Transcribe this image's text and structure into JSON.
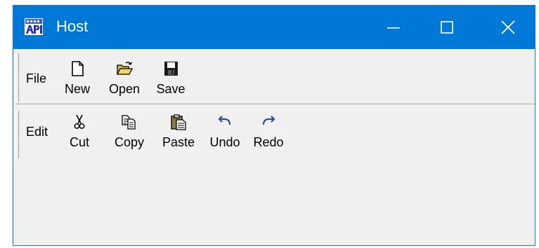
{
  "window": {
    "title": "Host",
    "app_icon": "api-logo-icon",
    "titlebar_color": "#0078d7",
    "body_color": "#f0f0f0",
    "controls": [
      "minimize-icon",
      "maximize-icon",
      "close-icon"
    ]
  },
  "toolbars": {
    "file": {
      "label": "File",
      "buttons": [
        {
          "label": "New",
          "icon": "new-document-icon"
        },
        {
          "label": "Open",
          "icon": "open-folder-icon"
        },
        {
          "label": "Save",
          "icon": "save-disk-icon"
        }
      ]
    },
    "edit": {
      "label": "Edit",
      "buttons": [
        {
          "label": "Cut",
          "icon": "scissors-icon"
        },
        {
          "label": "Copy",
          "icon": "copy-icon"
        },
        {
          "label": "Paste",
          "icon": "paste-icon"
        },
        {
          "label": "Undo",
          "icon": "undo-icon"
        },
        {
          "label": "Redo",
          "icon": "redo-icon"
        }
      ]
    }
  }
}
